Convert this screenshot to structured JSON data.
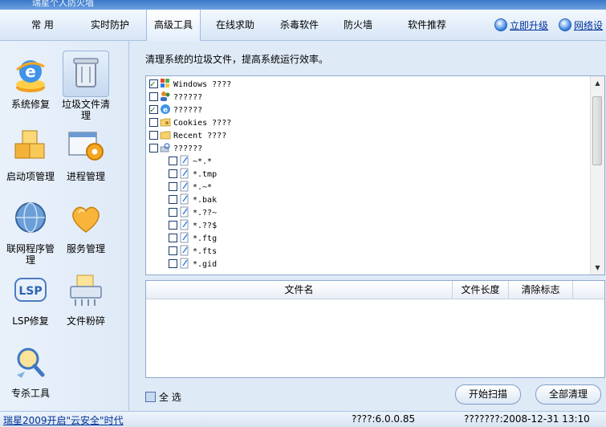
{
  "window": {
    "title": "瑞星个人防火墙"
  },
  "tabs": [
    {
      "label": "常 用"
    },
    {
      "label": "实时防护"
    },
    {
      "label": "高级工具"
    },
    {
      "label": "在线求助"
    },
    {
      "label": "杀毒软件"
    },
    {
      "label": "防火墙"
    },
    {
      "label": "软件推荐"
    }
  ],
  "active_tab": "高级工具",
  "top_links": {
    "upgrade": "立即升级",
    "network": "网络设"
  },
  "tools": [
    {
      "label": "系统修复",
      "icon": "ie-repair-icon"
    },
    {
      "label": "垃圾文件清理",
      "icon": "trash-can-icon"
    },
    {
      "label": "启动项管理",
      "icon": "startup-boxes-icon"
    },
    {
      "label": "进程管理",
      "icon": "process-gear-icon"
    },
    {
      "label": "联网程序管理",
      "icon": "globe-icon"
    },
    {
      "label": "服务管理",
      "icon": "heart-service-icon"
    },
    {
      "label": "LSP修复",
      "icon": "lsp-icon"
    },
    {
      "label": "文件粉碎",
      "icon": "shredder-icon"
    },
    {
      "label": "专杀工具",
      "icon": "magnifier-bug-icon"
    }
  ],
  "main": {
    "description": "清理系统的垃圾文件，提高系统运行效率。",
    "tree": [
      {
        "label": "Windows ????",
        "checked": true,
        "icon": "windows-flag-icon",
        "level": 0
      },
      {
        "label": "??????",
        "checked": false,
        "icon": "users-icon",
        "level": 0
      },
      {
        "label": "??????",
        "checked": true,
        "icon": "ie-icon",
        "level": 0
      },
      {
        "label": "Cookies ????",
        "checked": false,
        "icon": "cookie-folder-icon",
        "level": 0
      },
      {
        "label": "Recent ????",
        "checked": false,
        "icon": "folder-icon",
        "level": 0
      },
      {
        "label": "??????",
        "checked": false,
        "icon": "search-disk-icon",
        "level": 0
      },
      {
        "label": "~*.*",
        "checked": false,
        "icon": "file-icon",
        "level": 1
      },
      {
        "label": "*.tmp",
        "checked": false,
        "icon": "file-icon",
        "level": 1
      },
      {
        "label": "*.~*",
        "checked": false,
        "icon": "file-icon",
        "level": 1
      },
      {
        "label": "*.bak",
        "checked": false,
        "icon": "file-icon",
        "level": 1
      },
      {
        "label": "*.??~",
        "checked": false,
        "icon": "file-icon",
        "level": 1
      },
      {
        "label": "*.??$",
        "checked": false,
        "icon": "file-icon",
        "level": 1
      },
      {
        "label": "*.ftg",
        "checked": false,
        "icon": "file-icon",
        "level": 1
      },
      {
        "label": "*.fts",
        "checked": false,
        "icon": "file-icon",
        "level": 1
      },
      {
        "label": "*.gid",
        "checked": false,
        "icon": "file-icon",
        "level": 1
      }
    ],
    "list_columns": [
      "文件名",
      "文件长度",
      "清除标志"
    ],
    "select_all": "全 选",
    "scan_button": "开始扫描",
    "clean_button": "全部清理"
  },
  "status": {
    "link": "瑞星2009开启\"云安全\"时代",
    "version": "????:6.0.0.85",
    "date": "???????:2008-12-31 13:10"
  },
  "colors": {
    "accent": "#2f7be0",
    "background": "#dfeaf7",
    "link": "#003399"
  }
}
